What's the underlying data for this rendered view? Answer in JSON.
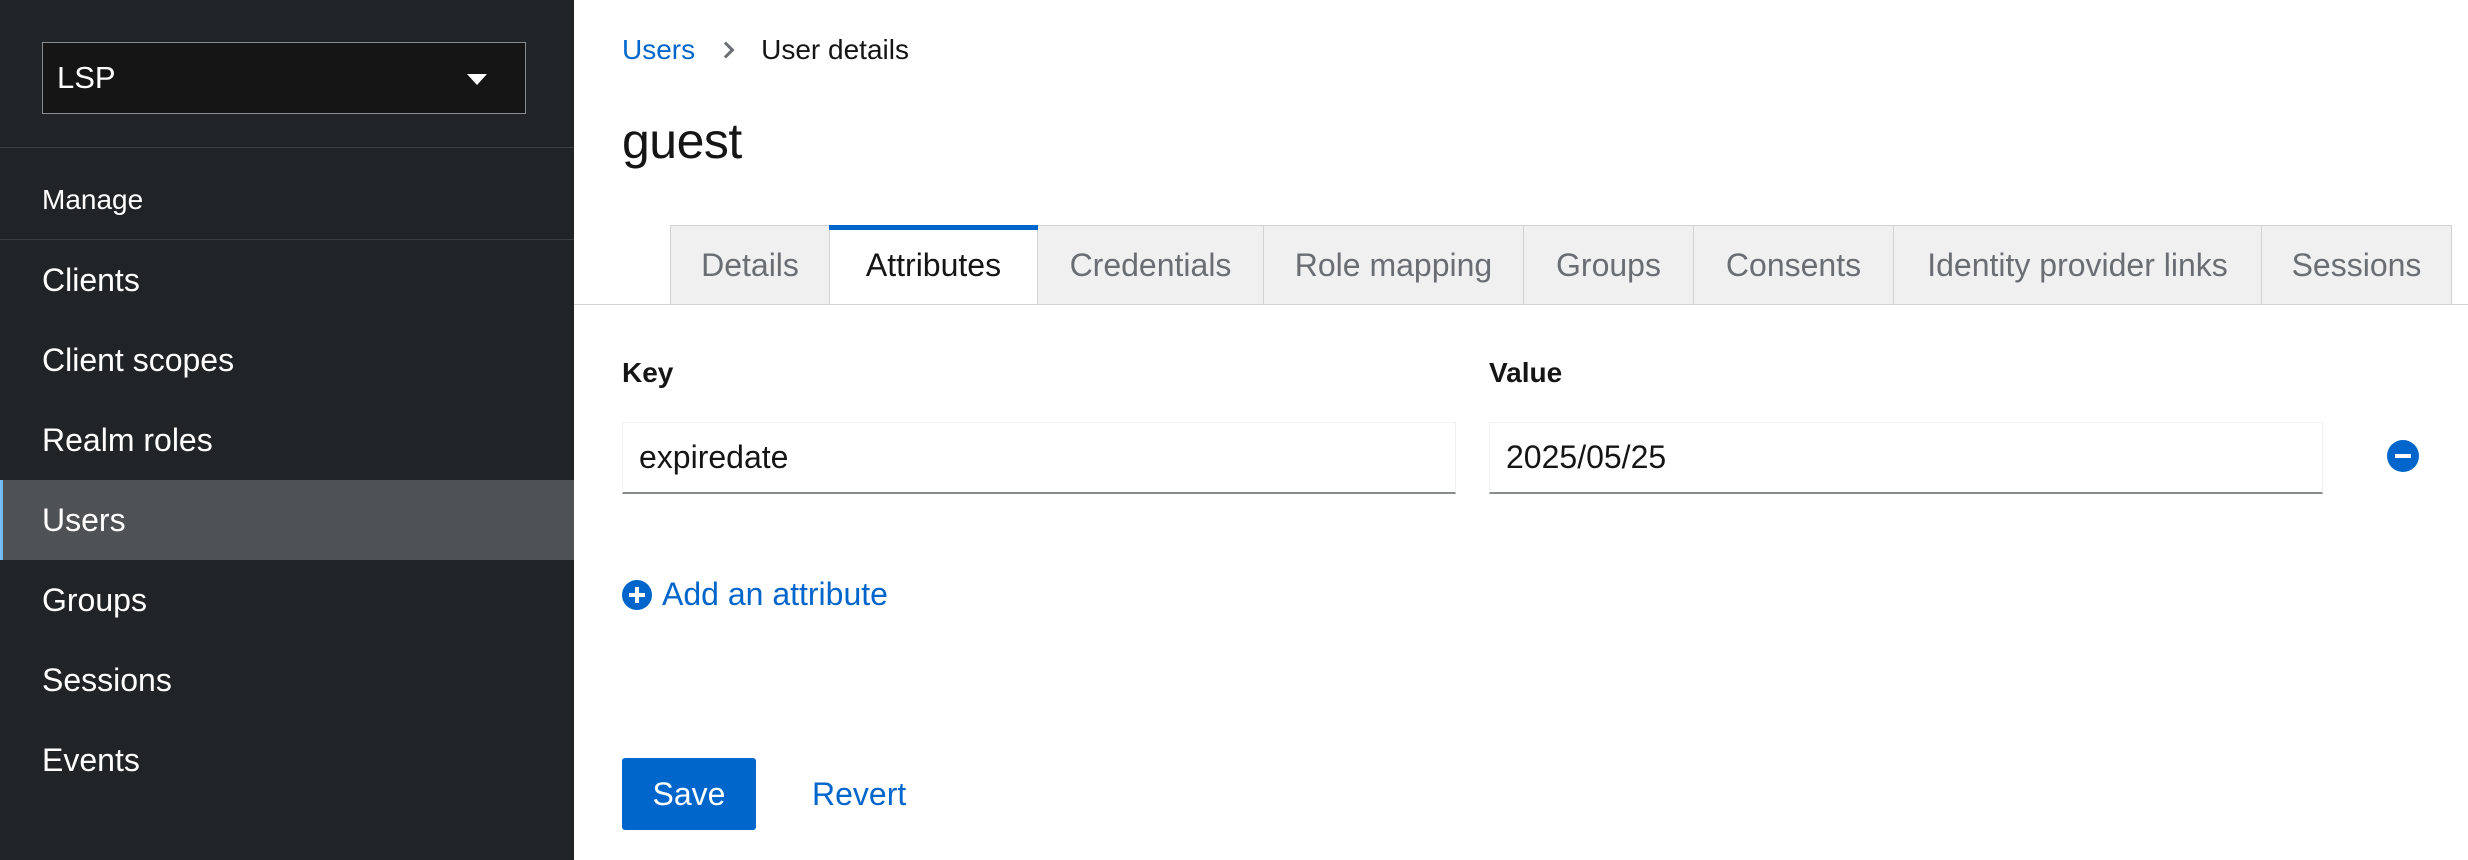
{
  "sidebar": {
    "realm_selector": {
      "value": "LSP",
      "icon": "caret-down-icon"
    },
    "section_title": "Manage",
    "items": [
      {
        "label": "Clients"
      },
      {
        "label": "Client scopes"
      },
      {
        "label": "Realm roles"
      },
      {
        "label": "Users",
        "active": true
      },
      {
        "label": "Groups"
      },
      {
        "label": "Sessions"
      },
      {
        "label": "Events"
      }
    ]
  },
  "breadcrumb": {
    "parent": "Users",
    "current": "User details"
  },
  "page": {
    "title": "guest"
  },
  "tabs": [
    {
      "label": "Details"
    },
    {
      "label": "Attributes",
      "active": true
    },
    {
      "label": "Credentials"
    },
    {
      "label": "Role mapping"
    },
    {
      "label": "Groups"
    },
    {
      "label": "Consents"
    },
    {
      "label": "Identity provider links"
    },
    {
      "label": "Sessions"
    }
  ],
  "attributes": {
    "key_label": "Key",
    "value_label": "Value",
    "rows": [
      {
        "key": "expiredate",
        "value": "2025/05/25"
      }
    ],
    "add_label": "Add an attribute"
  },
  "actions": {
    "save_label": "Save",
    "revert_label": "Revert"
  },
  "colors": {
    "accent": "#0066cc",
    "sidebar_bg": "#212427",
    "sidebar_active_bg": "#4f5255"
  }
}
